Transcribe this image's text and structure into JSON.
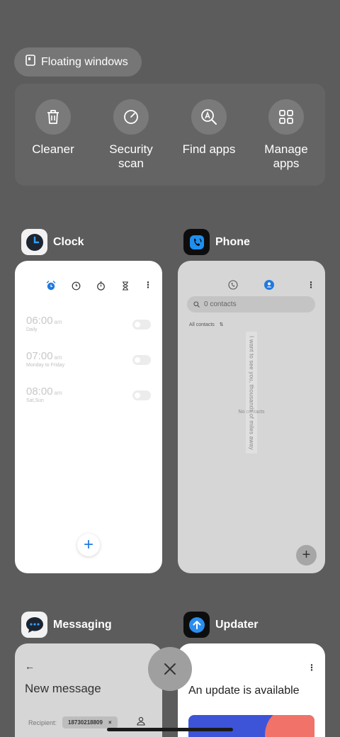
{
  "floating": {
    "label": "Floating windows",
    "icon": "window-icon"
  },
  "quick_actions": [
    {
      "label": "Cleaner",
      "icon": "trash-icon"
    },
    {
      "label": "Security scan",
      "icon": "security-scan-icon"
    },
    {
      "label": "Find apps",
      "icon": "find-apps-icon"
    },
    {
      "label": "Manage apps",
      "icon": "grid-icon"
    }
  ],
  "apps": {
    "clock": {
      "name": "Clock",
      "alarms": [
        {
          "time": "06:00",
          "ampm": "am",
          "sub": "Daily"
        },
        {
          "time": "07:00",
          "ampm": "am",
          "sub": "Monday to Friday"
        },
        {
          "time": "08:00",
          "ampm": "am",
          "sub": "Sat,Sun"
        }
      ],
      "fab": "+"
    },
    "phone": {
      "name": "Phone",
      "search_placeholder": "0 contacts",
      "filter": "All contacts",
      "empty": "No contacts",
      "overlay_text": "I want to see you, thousands of miles away",
      "fab": "+"
    },
    "messaging": {
      "name": "Messaging",
      "back": "←",
      "title": "New message",
      "recipient_label": "Recipient:",
      "recipient": "18730218809",
      "remove": "×"
    },
    "updater": {
      "name": "Updater",
      "title": "An update is available"
    }
  },
  "colors": {
    "accent": "#1f7ae0",
    "background": "#5c5c5c"
  }
}
